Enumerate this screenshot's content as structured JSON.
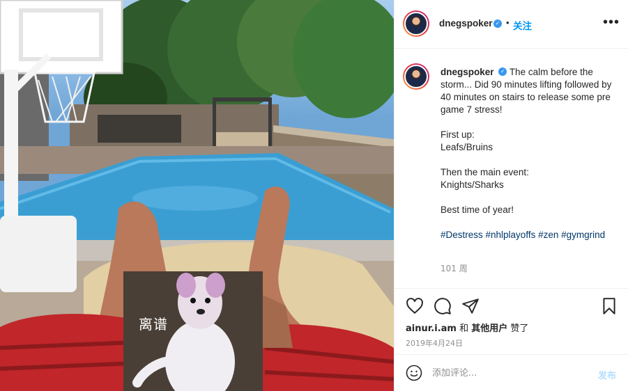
{
  "post": {
    "username": "dnegspoker",
    "follow_label": "关注",
    "separator": "•",
    "more_label": "•••"
  },
  "caption": {
    "username": "dnegspoker",
    "text_line1": "The calm before the storm... Did 90 minutes lifting followed by 40 minutes on stairs to release some pre game 7 stress!",
    "text_line2": "First up:",
    "text_line3": "Leafs/Bruins",
    "text_line4": "Then the main event:",
    "text_line5": "Knights/Sharks",
    "text_line6": "Best time of year!",
    "hashtags": "#Destress #nhlplayoffs #zen #gymgrind",
    "time_ago": "101 周"
  },
  "actions": {
    "liked_by_user": "ainur.i.am",
    "liked_and": "和",
    "liked_others": "其他用户",
    "liked_suffix": "赞了",
    "date": "2019年4月24日"
  },
  "comment": {
    "placeholder": "添加评论...",
    "post_label": "发布"
  },
  "meme": {
    "text": "离谱"
  },
  "colors": {
    "accent": "#0095f6",
    "verified": "#3897f0",
    "hashtag": "#00376b",
    "muted": "#8e8e8e"
  },
  "icons": [
    "verified-badge-icon",
    "heart-icon",
    "comment-icon",
    "share-icon",
    "bookmark-icon",
    "emoji-icon",
    "more-icon"
  ]
}
